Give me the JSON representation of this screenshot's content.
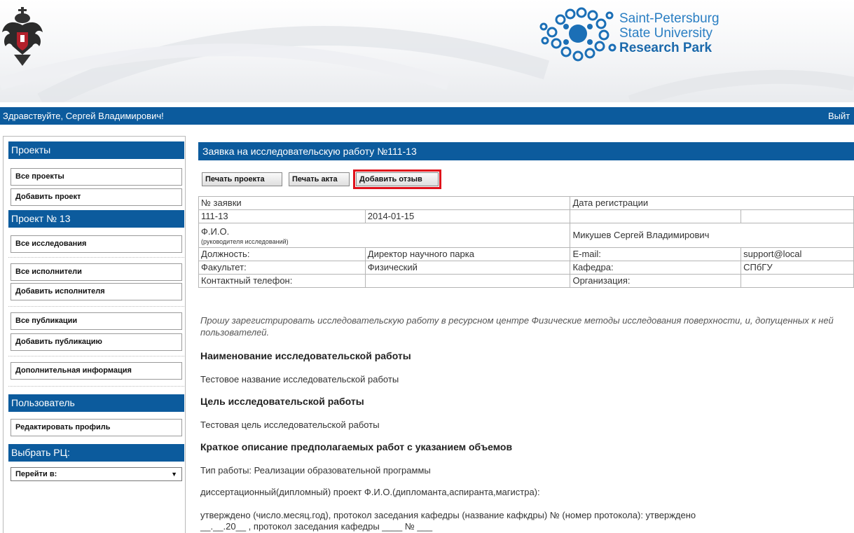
{
  "header": {
    "crest_icon": "spbu-crest-icon",
    "park_logo_icon": "research-park-logo-icon",
    "park_name_line1": "Saint-Petersburg",
    "park_name_line2": "State University",
    "park_name_line3": "Research Park"
  },
  "greeting": {
    "text": "Здравствуйте, Сергей Владимирович!",
    "logout": "Выйт"
  },
  "sidebar": {
    "projects_header": "Проекты",
    "all_projects": "Все проекты",
    "add_project": "Добавить проект",
    "project_header": "Проект № 13",
    "all_research": "Все исследования",
    "all_executors": "Все исполнители",
    "add_executor": "Добавить исполнителя",
    "all_publications": "Все публикации",
    "add_publication": "Добавить публикацию",
    "additional_info": "Дополнительная информация",
    "user_header": "Пользователь",
    "edit_profile": "Редактировать профиль",
    "rc_header": "Выбрать РЦ:",
    "goto_select": "Перейти в:"
  },
  "main": {
    "title": "Заявка на исследовательскую работу №111-13",
    "buttons": {
      "print_project": "Печать проекта",
      "print_act": "Печать акта",
      "add_review": "Добавить отзыв"
    },
    "table": {
      "request_no_label": "№ заявки",
      "reg_date_label": "Дата регистрации",
      "request_no": "111-13",
      "reg_date": "2014-01-15",
      "fio_label": "Ф.И.О.",
      "fio_sublabel": "(руководителя исследований)",
      "fio_value": "Микушев Сергей Владимирович",
      "position_label": "Должность:",
      "position_value": "Директор научного парка",
      "email_label": "E-mail:",
      "email_value": "support@local",
      "faculty_label": "Факультет:",
      "faculty_value": "Физический",
      "department_label": "Кафедра:",
      "department_value": "СПбГУ",
      "phone_label": "Контактный телефон:",
      "phone_value": "",
      "organization_label": "Организация:",
      "organization_value": ""
    },
    "intro": "Прошу зарегистрировать исследовательскую работу в ресурсном центре Физические методы исследования поверхности, и, допущенных к ней пользователей.",
    "name_heading": "Наименование исследовательской работы",
    "name_value": "Тестовое название исследовательской работы",
    "goal_heading": "Цель исследовательской работы",
    "goal_value": "Тестовая цель исследовательской работы",
    "desc_heading": "Краткое описание предполагаемых работ с указанием объемов",
    "work_type": "Тип работы: Реализации образовательной программы",
    "thesis": "диссертационный(дипломный) проект Ф.И.О.(дипломанта,аспиранта,магистра):",
    "approved_line1": "утверждено (число.месяц.год), протокол заседания кафедры (название кафкдры) № (номер протокола): утверждено",
    "approved_line2": "__.__.20__ , протокол заседания кафедры ____ № ___"
  }
}
